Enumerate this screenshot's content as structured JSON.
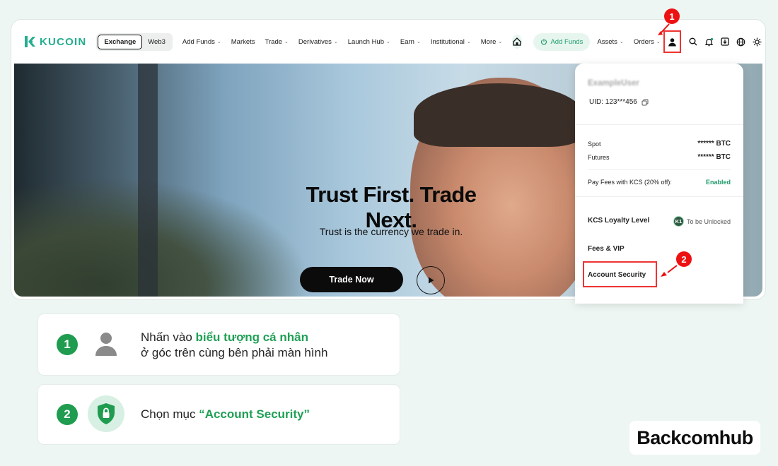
{
  "nav": {
    "logo_text": "KUCOIN",
    "segment": [
      "Exchange",
      "Web3"
    ],
    "items": [
      {
        "label": "Add Funds",
        "chevron": true
      },
      {
        "label": "Markets",
        "chevron": false
      },
      {
        "label": "Trade",
        "chevron": true
      },
      {
        "label": "Derivatives",
        "chevron": true
      },
      {
        "label": "Launch Hub",
        "chevron": true
      },
      {
        "label": "Earn",
        "chevron": true
      },
      {
        "label": "Institutional",
        "chevron": true
      },
      {
        "label": "More",
        "chevron": true
      }
    ],
    "add_funds_pill": "Add Funds",
    "assets": "Assets",
    "orders": "Orders"
  },
  "hero": {
    "headline": "Trust First. Trade Next.",
    "subline": "Trust is the currency we trade in.",
    "cta": "Trade Now"
  },
  "dropdown": {
    "username": "ExampleUser",
    "uid": "UID: 123***456",
    "spot_label": "Spot",
    "spot_value": "****** BTC",
    "futures_label": "Futures",
    "futures_value": "****** BTC",
    "fees_label": "Pay Fees with KCS (20% off):",
    "fees_status": "Enabled",
    "loyalty_label": "KCS Loyalty Level",
    "loyalty_badge": "K1",
    "loyalty_status": "To be Unlocked",
    "fees_vip": "Fees & VIP",
    "account_security": "Account Security"
  },
  "callouts": [
    "1",
    "2"
  ],
  "steps": [
    {
      "num": "1",
      "pre": "Nhấn vào ",
      "highlight": "biểu tượng cá nhân",
      "line2": "ở góc trên cùng bên phải màn hình"
    },
    {
      "num": "2",
      "pre": "Chọn mục ",
      "highlight": "“Account Security”"
    }
  ],
  "brand": "Backcomhub",
  "colors": {
    "accent": "#1f9c4f",
    "kucoin": "#24ae8f",
    "callout": "#e11111"
  }
}
